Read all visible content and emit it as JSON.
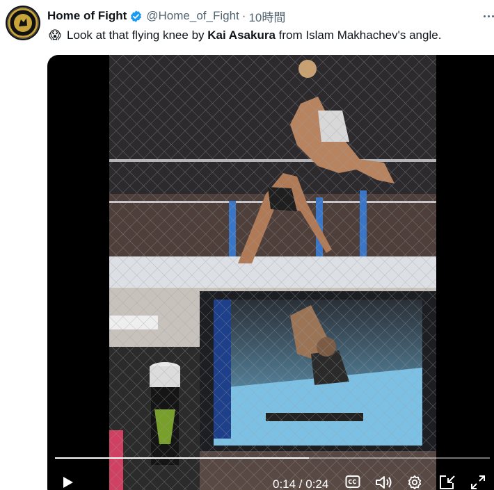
{
  "tweet": {
    "display_name": "Home of Fight",
    "handle": "@Home_of_Fight",
    "separator": "·",
    "time": "10時間",
    "emoji": "😱",
    "text_part1": "Look at that flying knee by ",
    "text_bold": "Kai Asakura",
    "text_part2": " from Islam Makhachev's angle.",
    "icons": {
      "avatar": "home-of-fight-logo",
      "verified": "verified-badge-icon",
      "more": "more-options-icon"
    }
  },
  "video": {
    "current_time": "0:14",
    "duration": "0:24",
    "time_display": "0:14 / 0:24",
    "progress_fraction": 0.5833,
    "controls": [
      "play-icon",
      "closed-captions-icon",
      "volume-icon",
      "settings-gear-icon",
      "picture-in-picture-icon",
      "fullscreen-icon"
    ]
  },
  "colors": {
    "verified_blue": "#1d9bf0",
    "text_primary": "#0f1419",
    "text_secondary": "#536471",
    "media_background": "#000000"
  }
}
